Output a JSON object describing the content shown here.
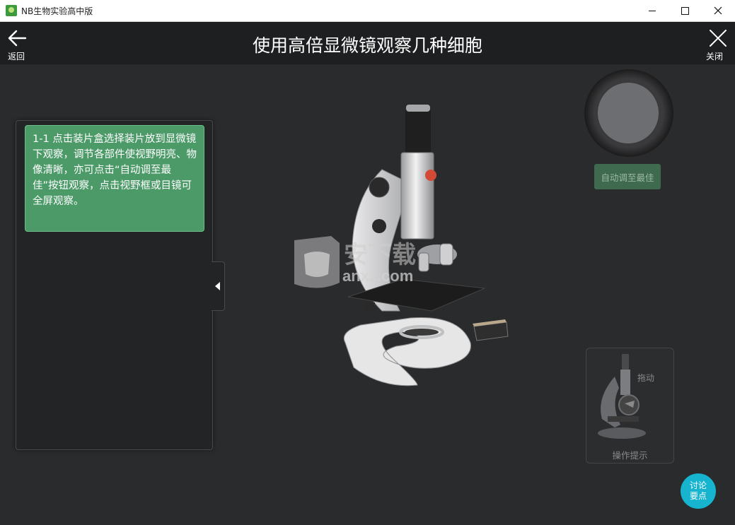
{
  "window": {
    "title": "NB生物实验高中版"
  },
  "header": {
    "back_label": "返回",
    "title": "使用高倍显微镜观察几种细胞",
    "close_label": "关闭"
  },
  "instructions": {
    "step_text": "1-1 点击装片盒选择装片放到显微镜下观察，调节各部件使视野明亮、物像清晰，亦可点击“自动调至最佳”按钮观察，点击视野框或目镜可全屏观察。"
  },
  "controls": {
    "auto_adjust_label": "自动调至最佳",
    "drag_label": "拖动",
    "hint_label": "操作提示",
    "discuss_label_1": "讨论",
    "discuss_label_2": "要点"
  },
  "watermark": {
    "text": "anxz.com"
  },
  "colors": {
    "background": "#2a2b2d",
    "header": "#1e1f21",
    "step_card": "#4b9a68",
    "auto_button": "#3f6a4f",
    "discuss_button": "#17b4d0"
  }
}
